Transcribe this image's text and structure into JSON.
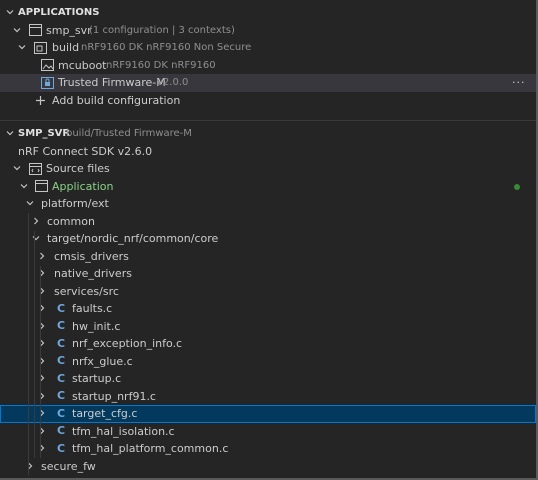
{
  "applications_header": {
    "title": "APPLICATIONS"
  },
  "app": {
    "name": "smp_svr",
    "desc": "(1 configuration | 3 contexts)"
  },
  "build": {
    "name": "build",
    "desc": "nRF9160 DK nRF9160 Non Secure"
  },
  "mcuboot": {
    "name": "mcuboot",
    "desc": "nRF9160 DK nRF9160"
  },
  "tfm": {
    "name": "Trusted Firmware-M",
    "desc": "v2.0.0",
    "more": "···"
  },
  "add_build": {
    "label": "Add build configuration"
  },
  "details_header": {
    "title": "SMP_SVR",
    "desc": "build/Trusted Firmware-M"
  },
  "sdk_version": "nRF Connect SDK v2.6.0",
  "tree": {
    "source_files": "Source files",
    "application": "Application",
    "platform_ext": "platform/ext",
    "common": "common",
    "target_core": "target/nordic_nrf/common/core",
    "cmsis_drivers": "cmsis_drivers",
    "native_drivers": "native_drivers",
    "services_src": "services/src",
    "files": [
      "faults.c",
      "hw_init.c",
      "nrf_exception_info.c",
      "nrfx_glue.c",
      "startup.c",
      "startup_nrf91.c",
      "target_cfg.c",
      "tfm_hal_isolation.c",
      "tfm_hal_platform_common.c"
    ],
    "secure_fw": "secure_fw",
    "c_glyph": "C"
  },
  "colors": {
    "accent": "#0078d4",
    "status_dot": "#388a34",
    "c_file": "#6fa8dc",
    "application": "#89d185"
  }
}
